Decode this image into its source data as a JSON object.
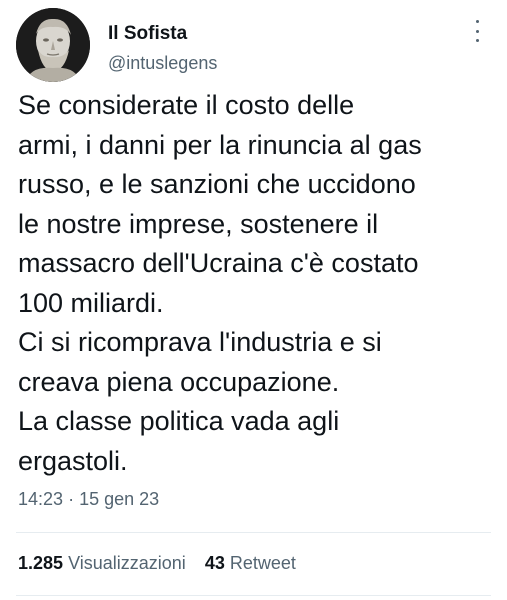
{
  "author": {
    "name": "Il Sofista",
    "handle": "@intuslegens"
  },
  "tweet": {
    "text": "Se considerate il costo delle\narmi, i danni per la rinuncia al gas\nrusso, e le sanzioni che uccidono\nle nostre imprese, sostenere il\nmassacro dell'Ucraina c'è costato\n100 miliardi.\nCi si ricomprava l'industria e si\ncreava piena occupazione.\nLa classe politica vada agli\nergastoli.",
    "time": "14:23",
    "separator": "·",
    "date": "15 gen 23"
  },
  "stats": {
    "views_count": "1.285",
    "views_label": "Visualizzazioni",
    "retweets_count": "43",
    "retweets_label": "Retweet"
  },
  "icons": {
    "avatar": "bust-statue-avatar",
    "more": "more-options-icon"
  },
  "colors": {
    "text": "#0f1419",
    "secondary": "#536471",
    "divider": "#e6ecf0"
  }
}
